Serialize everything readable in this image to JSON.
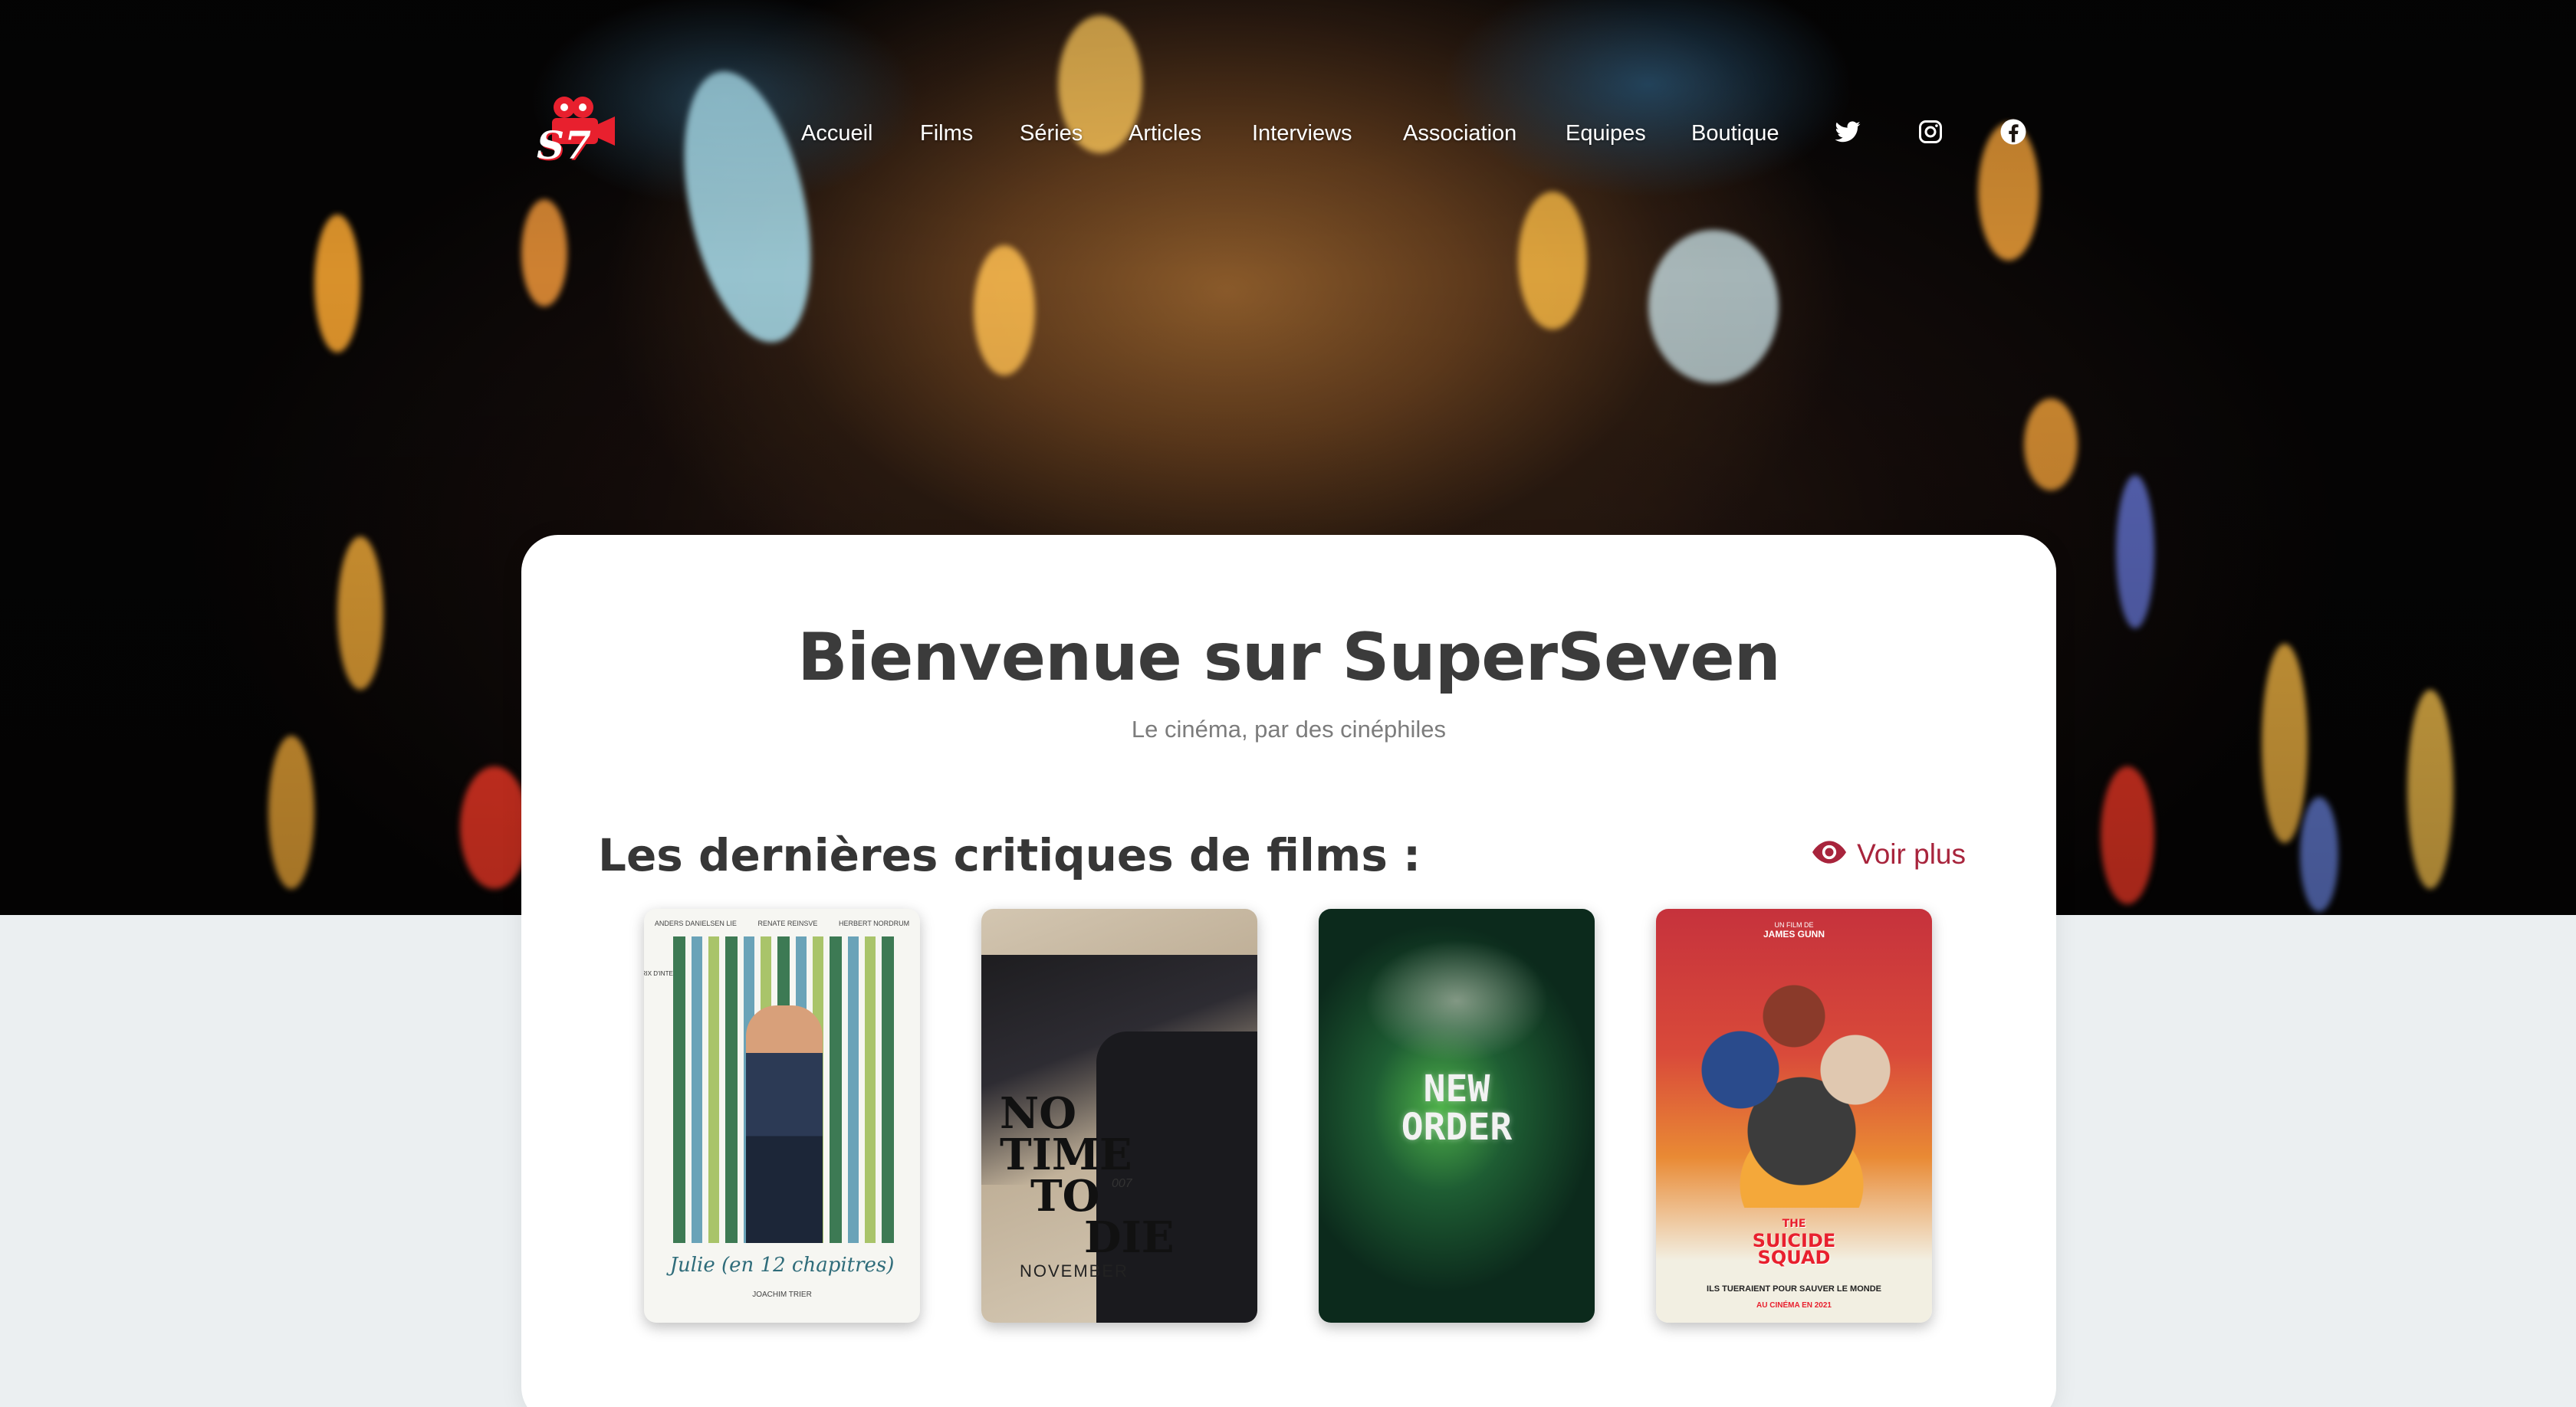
{
  "nav": {
    "items": [
      {
        "label": "Accueil"
      },
      {
        "label": "Films"
      },
      {
        "label": "Séries"
      },
      {
        "label": "Articles"
      },
      {
        "label": "Interviews"
      },
      {
        "label": "Association"
      },
      {
        "label": "Equipes"
      },
      {
        "label": "Boutique"
      }
    ],
    "social": [
      "twitter-icon",
      "instagram-icon",
      "facebook-icon"
    ]
  },
  "logo": {
    "text": "S7",
    "color": "#e8202e"
  },
  "hero": {
    "title": "Bienvenue sur SuperSeven",
    "subtitle": "Le cinéma, par des cinéphiles"
  },
  "reviews": {
    "title": "Les dernières critiques de films :",
    "more_label": "Voir plus",
    "more_icon": "eye-icon",
    "accent": "#a8243c",
    "posters": [
      {
        "top_names": [
          "ANDERS DANIELSEN LIE",
          "RENATE REINSVE",
          "HERBERT NORDRUM"
        ],
        "award": "PRIX D'INTERPRÉTATION FÉMININE",
        "title": "Julie (en 12 chapitres)",
        "director": "JOACHIM TRIER"
      },
      {
        "title_lines": [
          "NO",
          "TIME",
          "TO",
          "DIE"
        ],
        "tag": "007",
        "month": "NOVEMBER"
      },
      {
        "title_lines": [
          "NEW",
          "ORDER"
        ]
      },
      {
        "director_credit": "UN FILM DE",
        "director": "JAMES GUNN",
        "title_lines": [
          "THE",
          "SUICIDE",
          "SQUAD"
        ],
        "tagline": "ILS TUERAIENT POUR SAUVER LE MONDE",
        "release": "AU CINÉMA EN 2021"
      }
    ]
  }
}
